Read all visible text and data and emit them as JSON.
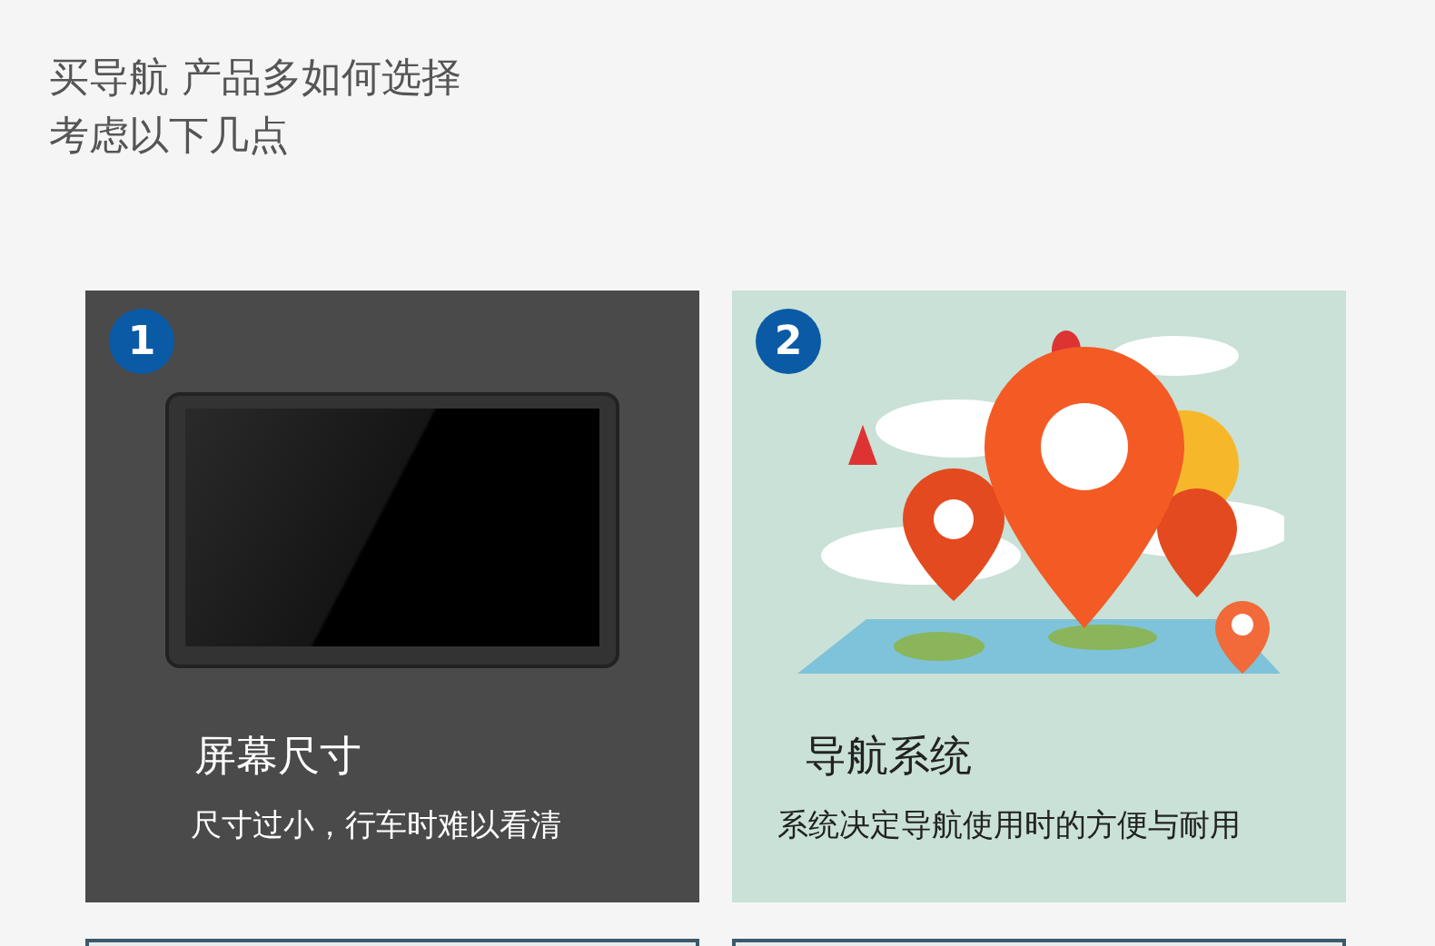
{
  "heading": {
    "lines": [
      "买导航 产品多如何选择",
      "考虑以下几点"
    ]
  },
  "cards": [
    {
      "kind": "device",
      "number": "1",
      "title": "屏幕尺寸",
      "subtitle": "尺寸过小，行车时难以看清"
    },
    {
      "kind": "map",
      "number": "2",
      "title": "导航系统",
      "subtitle": "系统决定导航使用时的方便与耐用"
    }
  ]
}
